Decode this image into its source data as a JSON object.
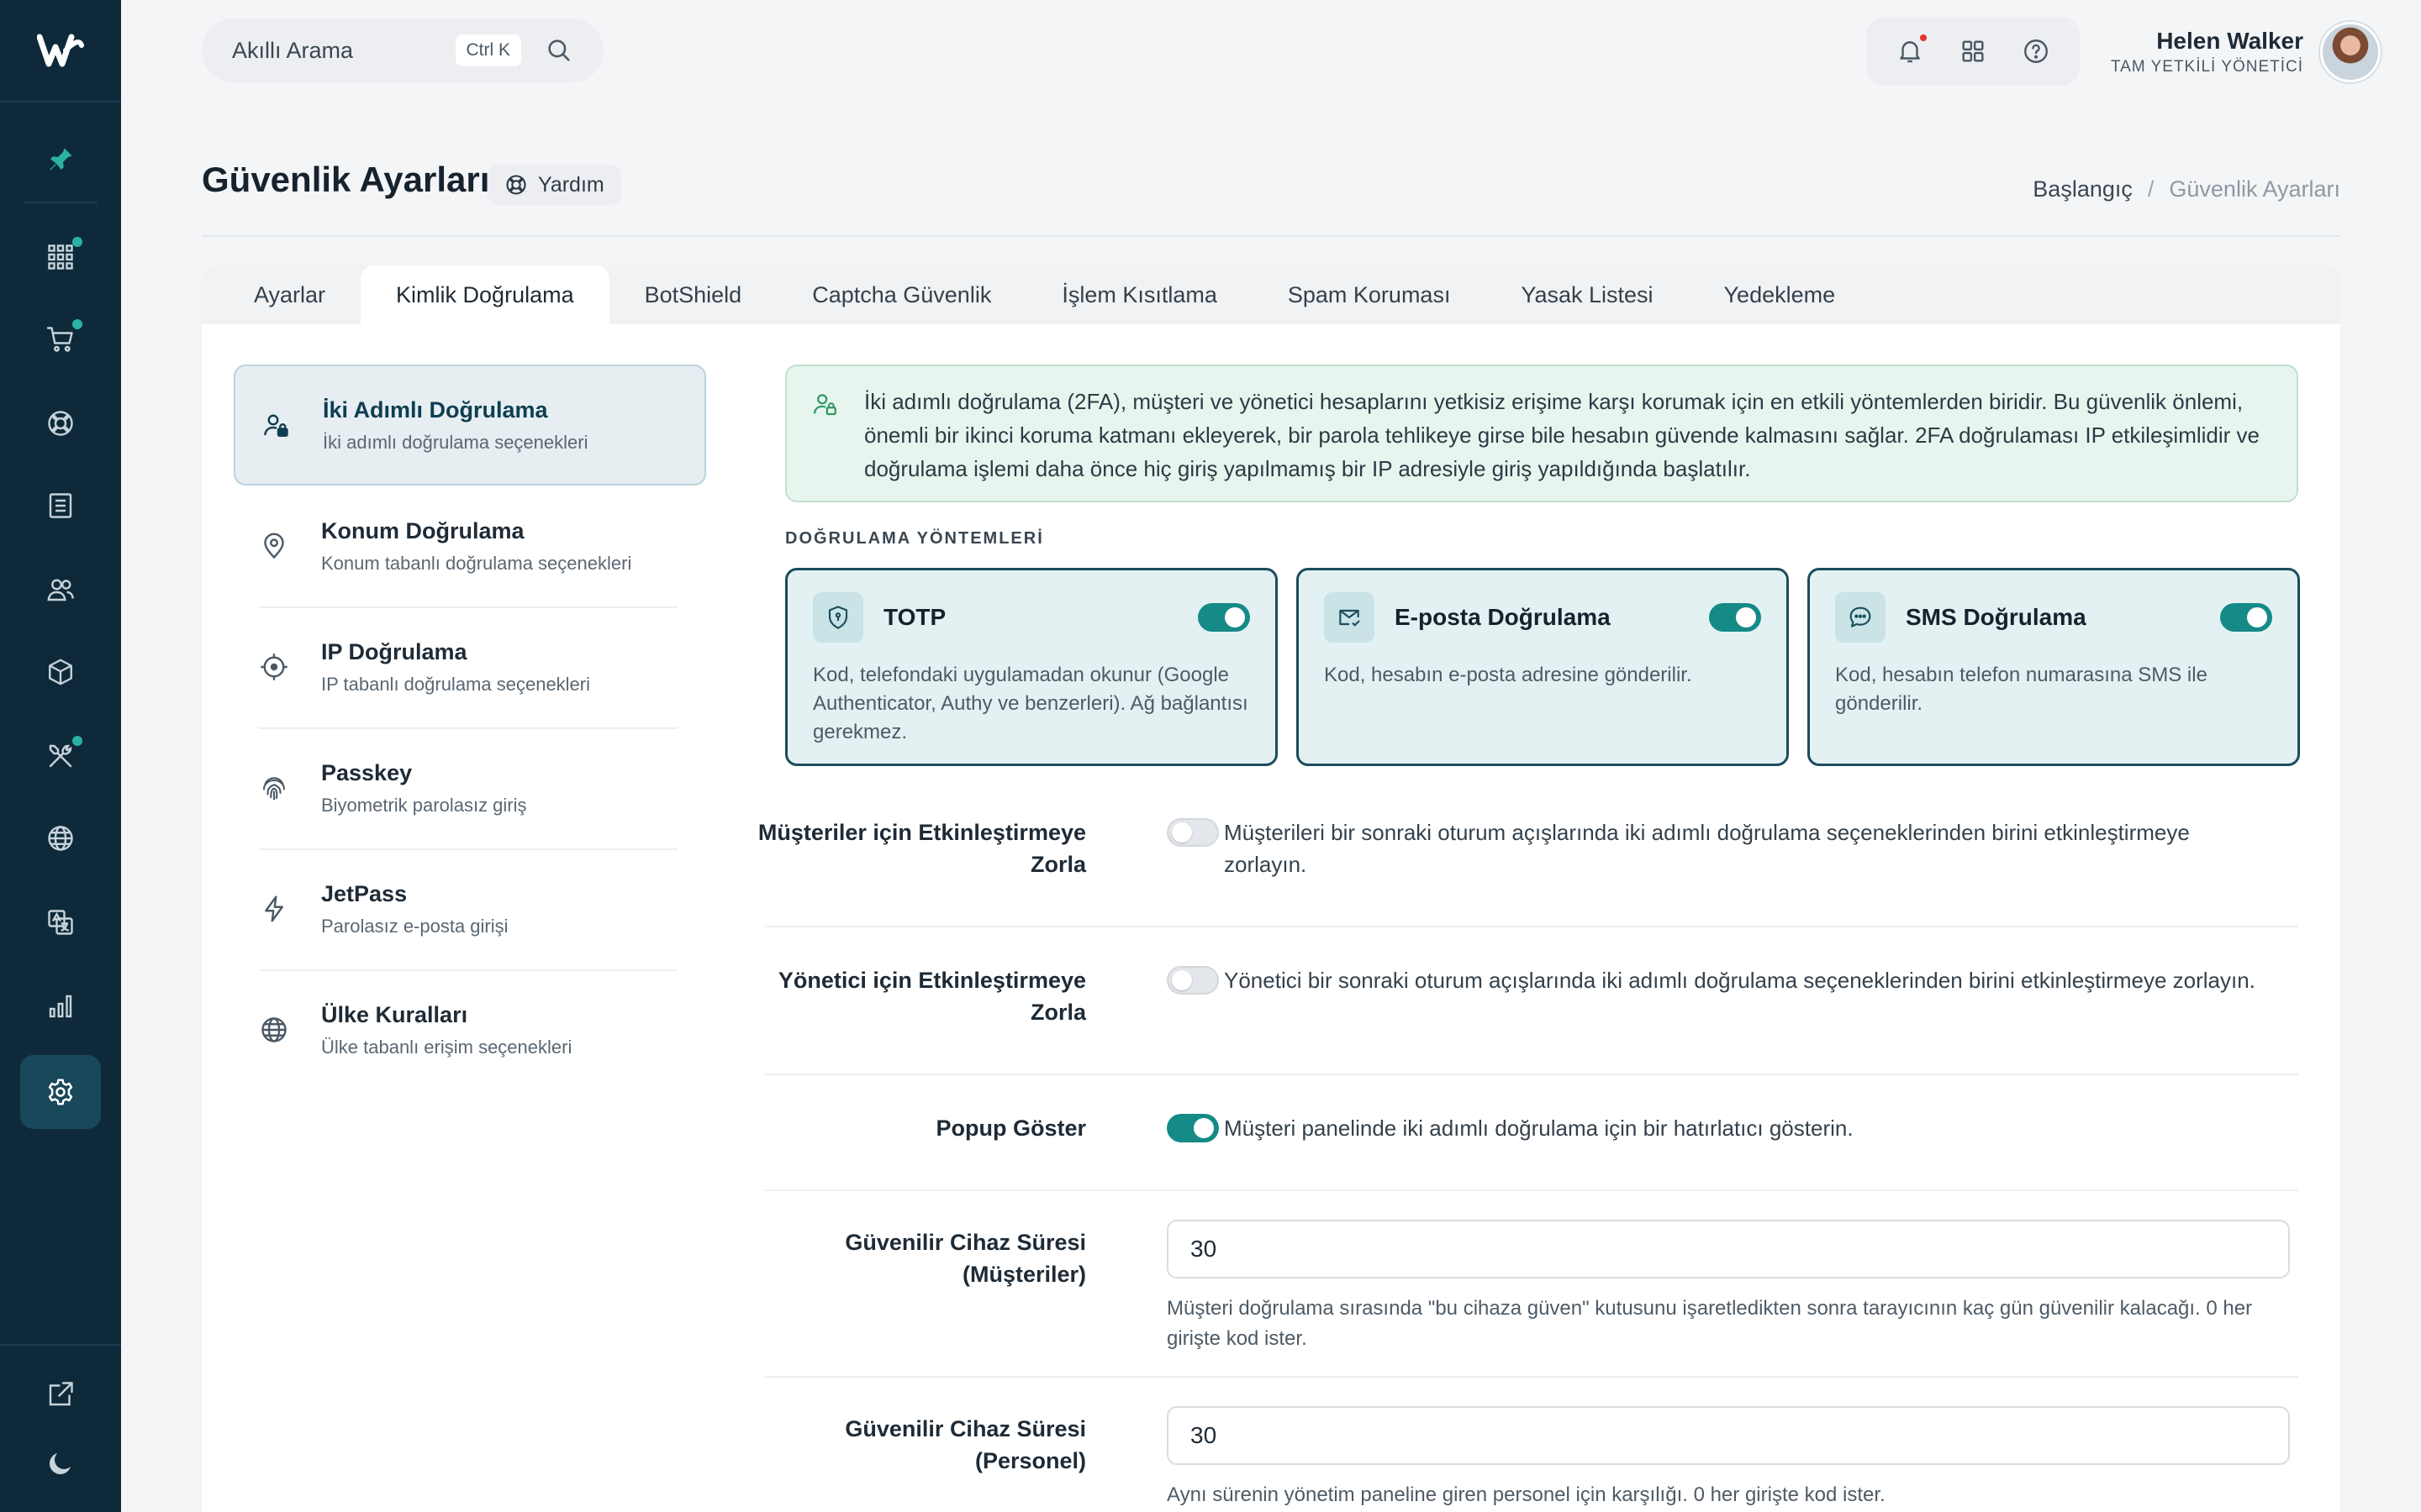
{
  "sidebar": {
    "logo_icon": "w-logo-icon",
    "items": [
      {
        "icon": "pin-icon",
        "active": false,
        "dot": false
      },
      {
        "icon": "apps-grid-icon",
        "active": false,
        "dot": true
      },
      {
        "icon": "cart-icon",
        "active": false,
        "dot": true
      },
      {
        "icon": "lifebuoy-icon",
        "active": false,
        "dot": false
      },
      {
        "icon": "document-list-icon",
        "active": false,
        "dot": false
      },
      {
        "icon": "users-icon",
        "active": false,
        "dot": false
      },
      {
        "icon": "box-icon",
        "active": false,
        "dot": false
      },
      {
        "icon": "tools-icon",
        "active": false,
        "dot": true
      },
      {
        "icon": "globe-icon",
        "active": false,
        "dot": false
      },
      {
        "icon": "translate-icon",
        "active": false,
        "dot": false
      },
      {
        "icon": "bar-chart-icon",
        "active": false,
        "dot": false
      },
      {
        "icon": "gear-icon",
        "active": true,
        "dot": false
      }
    ],
    "bottom": [
      "external-link-icon",
      "moon-icon"
    ]
  },
  "search": {
    "placeholder": "Akıllı Arama",
    "shortcut": "Ctrl K"
  },
  "user": {
    "name": "Helen Walker",
    "role": "TAM YETKİLİ YÖNETİCİ"
  },
  "page": {
    "title": "Güvenlik Ayarları",
    "help": "Yardım",
    "breadcrumb": {
      "home": "Başlangıç",
      "separator": "/",
      "current": "Güvenlik Ayarları"
    }
  },
  "tabs": [
    {
      "label": "Ayarlar",
      "active": false
    },
    {
      "label": "Kimlik Doğrulama",
      "active": true
    },
    {
      "label": "BotShield",
      "active": false
    },
    {
      "label": "Captcha Güvenlik",
      "active": false
    },
    {
      "label": "İşlem Kısıtlama",
      "active": false
    },
    {
      "label": "Spam Koruması",
      "active": false
    },
    {
      "label": "Yasak Listesi",
      "active": false
    },
    {
      "label": "Yedekleme",
      "active": false
    }
  ],
  "left_nav": [
    {
      "icon": "user-lock-icon",
      "title": "İki Adımlı Doğrulama",
      "subtitle": "İki adımlı doğrulama seçenekleri",
      "active": true
    },
    {
      "icon": "location-pin-icon",
      "title": "Konum Doğrulama",
      "subtitle": "Konum tabanlı doğrulama seçenekleri",
      "active": false
    },
    {
      "icon": "target-icon",
      "title": "IP Doğrulama",
      "subtitle": "IP tabanlı doğrulama seçenekleri",
      "active": false
    },
    {
      "icon": "fingerprint-icon",
      "title": "Passkey",
      "subtitle": "Biyometrik parolasız giriş",
      "active": false
    },
    {
      "icon": "bolt-icon",
      "title": "JetPass",
      "subtitle": "Parolasız e-posta girişi",
      "active": false
    },
    {
      "icon": "globe-icon",
      "title": "Ülke Kuralları",
      "subtitle": "Ülke tabanlı erişim seçenekleri",
      "active": false
    }
  ],
  "info": {
    "icon": "user-lock-icon",
    "text": "İki adımlı doğrulama (2FA), müşteri ve yönetici hesaplarını yetkisiz erişime karşı korumak için en etkili yöntemlerden biridir. Bu güvenlik önlemi, önemli bir ikinci koruma katmanı ekleyerek, bir parola tehlikeye girse bile hesabın güvende kalmasını sağlar. 2FA doğrulaması IP etkileşimlidir ve doğrulama işlemi daha önce hiç giriş yapılmamış bir IP adresiyle giriş yapıldığında başlatılır."
  },
  "methods_label": "DOĞRULAMA YÖNTEMLERİ",
  "methods": [
    {
      "icon": "shield-icon",
      "title": "TOTP",
      "enabled": true,
      "desc": "Kod, telefondaki uygulamadan okunur (Google Authenticator, Authy ve benzerleri). Ağ bağlantısı gerekmez."
    },
    {
      "icon": "mail-check-icon",
      "title": "E-posta Doğrulama",
      "enabled": true,
      "desc": "Kod, hesabın e-posta adresine gönderilir."
    },
    {
      "icon": "chat-icon",
      "title": "SMS Doğrulama",
      "enabled": true,
      "desc": "Kod, hesabın telefon numarasına SMS ile gönderilir."
    }
  ],
  "settings": {
    "force_customers": {
      "label": "Müşteriler için Etkinleştirmeye Zorla",
      "enabled": false,
      "desc": "Müşterileri bir sonraki oturum açışlarında iki adımlı doğrulama seçeneklerinden birini etkinleştirmeye zorlayın."
    },
    "force_admin": {
      "label": "Yönetici için Etkinleştirmeye Zorla",
      "enabled": false,
      "desc": "Yönetici bir sonraki oturum açışlarında iki adımlı doğrulama seçeneklerinden birini etkinleştirmeye zorlayın."
    },
    "show_popup": {
      "label": "Popup Göster",
      "enabled": true,
      "desc": "Müşteri panelinde iki adımlı doğrulama için bir hatırlatıcı gösterin."
    },
    "trusted_customers": {
      "label": "Güvenilir Cihaz Süresi (Müşteriler)",
      "value": "30",
      "help": "Müşteri doğrulama sırasında \"bu cihaza güven\" kutusunu işaretledikten sonra tarayıcının kaç gün güvenilir kalacağı. 0 her girişte kod ister."
    },
    "trusted_staff": {
      "label": "Güvenilir Cihaz Süresi (Personel)",
      "value": "30",
      "help": "Aynı sürenin yönetim paneline giren personel için karşılığı. 0 her girişte kod ister."
    }
  }
}
